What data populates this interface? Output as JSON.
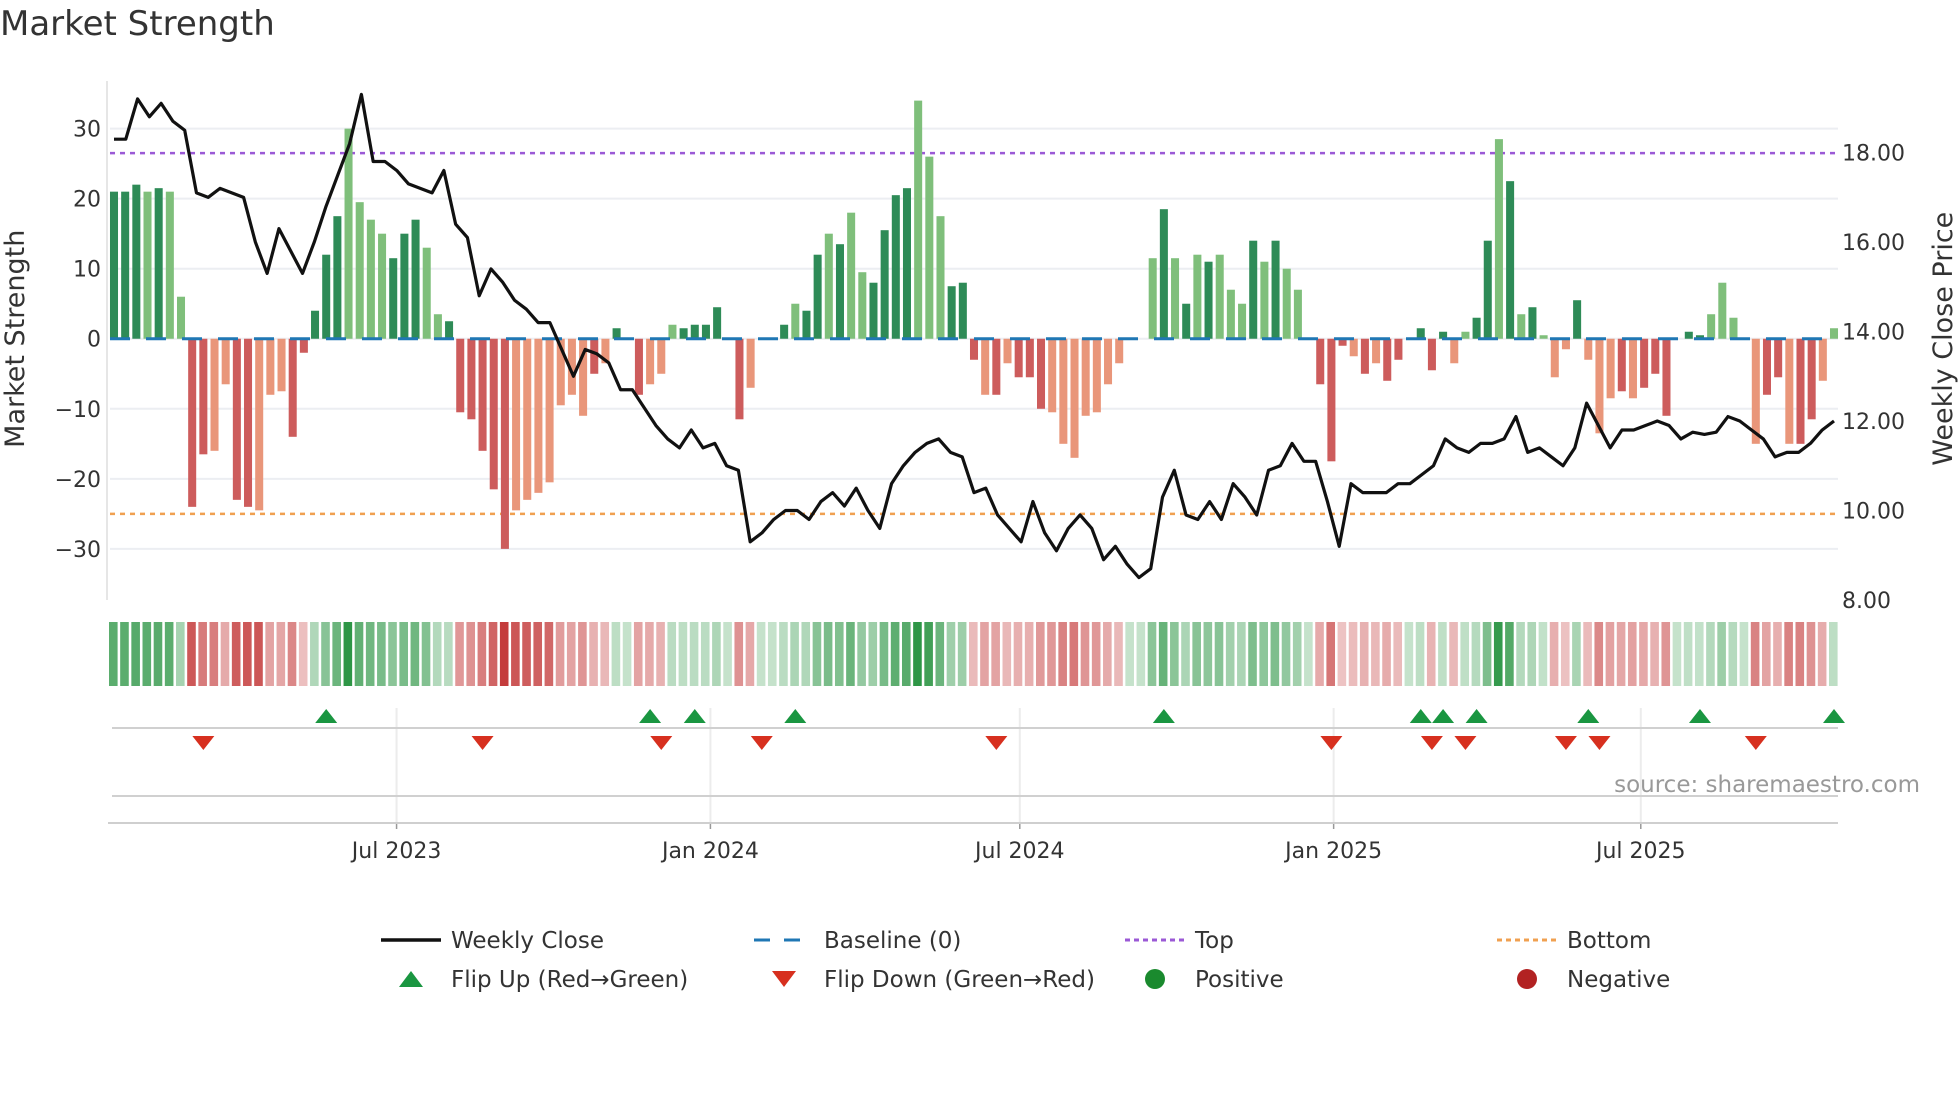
{
  "chart_data": {
    "type": "bar+line",
    "title": "Market Strength",
    "ylabel": "Market Strength",
    "y2label": "Weekly Close Price",
    "ylim": [
      -37.3,
      36.8
    ],
    "y2lim": [
      8.0,
      19.6
    ],
    "yticks": [
      30,
      20,
      10,
      0,
      -10,
      -20,
      -30
    ],
    "ytick_labels": [
      "30",
      "20",
      "10",
      "0",
      "−10",
      "−20",
      "−30"
    ],
    "y2ticks": [
      18,
      16,
      14,
      12,
      10,
      8
    ],
    "y2tick_labels": [
      "18.00",
      "16.00",
      "14.00",
      "12.00",
      "10.00",
      "8.00"
    ],
    "xticks": [
      {
        "label": "Jul 2023",
        "week_index": 25.3
      },
      {
        "label": "Jan 2024",
        "week_index": 53.4
      },
      {
        "label": "Jul 2024",
        "week_index": 81.1
      },
      {
        "label": "Jan 2025",
        "week_index": 109.2
      },
      {
        "label": "Jul 2025",
        "week_index": 136.7
      }
    ],
    "top_threshold": 26.5,
    "bottom_threshold": -25,
    "strength": [
      21,
      21,
      22,
      21,
      21.5,
      21,
      6,
      -24,
      -16.5,
      -16,
      -6.5,
      -23,
      -24,
      -24.5,
      -8,
      -7.5,
      -14,
      -2,
      4,
      12,
      17.5,
      30,
      19.5,
      17,
      15,
      11.5,
      15,
      17,
      13,
      3.5,
      2.5,
      -10.5,
      -11.5,
      -16,
      -21.5,
      -30,
      -24.5,
      -23,
      -22,
      -20.5,
      -9.5,
      -8,
      -11,
      -5,
      -3.5,
      1.5,
      0,
      -8,
      -6.5,
      -5,
      2,
      1.5,
      2,
      2,
      4.5,
      0,
      -11.5,
      -7,
      0,
      0,
      2,
      5,
      4,
      12,
      15,
      13.5,
      18,
      9.5,
      8,
      15.5,
      20.5,
      21.5,
      34,
      26,
      17.5,
      7.5,
      8,
      -3,
      -8,
      -8,
      -3.5,
      -5.5,
      -5.5,
      -10,
      -10.5,
      -15,
      -17,
      -11,
      -10.5,
      -6.5,
      -3.5,
      0,
      0,
      11.5,
      18.5,
      11.5,
      5,
      12,
      11,
      12,
      7,
      5,
      14,
      11,
      14,
      10,
      7,
      0,
      -6.5,
      -17.5,
      -1,
      -2.5,
      -5,
      -3.5,
      -6,
      -3,
      0,
      1.5,
      -4.5,
      1,
      -3.5,
      1,
      3,
      14,
      28.5,
      22.5,
      3.5,
      4.5,
      0.5,
      -5.5,
      -1.5,
      5.5,
      -3,
      -13.5,
      -8.5,
      -7.5,
      -8.5,
      -7,
      -5,
      -11,
      0,
      1,
      0.5,
      3.5,
      8,
      3,
      0,
      -15,
      -8,
      -5.5,
      -15,
      -15,
      -11.5,
      -6,
      1.5
    ],
    "shade": "dddldllddllddllldddddlllldddllddddddllllllldldldlllddddldllddlddldllddddllldddldldddlllllllddldldldllldldllldddldlddddddllddldldllldllldldddlddlllllddlddlldldllldd",
    "weekly_close": [
      18.3,
      18.3,
      19.2,
      18.8,
      19.1,
      18.7,
      18.5,
      17.1,
      17.0,
      17.2,
      17.1,
      17.0,
      16.0,
      15.3,
      16.3,
      15.8,
      15.3,
      16.0,
      16.8,
      17.5,
      18.2,
      19.3,
      17.8,
      17.8,
      17.6,
      17.3,
      17.2,
      17.1,
      17.6,
      16.4,
      16.1,
      14.8,
      15.4,
      15.1,
      14.7,
      14.5,
      14.2,
      14.2,
      13.6,
      13.0,
      13.6,
      13.5,
      13.3,
      12.7,
      12.7,
      12.3,
      11.9,
      11.6,
      11.4,
      11.8,
      11.4,
      11.5,
      11.0,
      10.9,
      9.3,
      9.5,
      9.8,
      10.0,
      10.0,
      9.8,
      10.2,
      10.4,
      10.1,
      10.5,
      10.0,
      9.6,
      10.6,
      11.0,
      11.3,
      11.5,
      11.6,
      11.3,
      11.2,
      10.4,
      10.5,
      9.9,
      9.6,
      9.3,
      10.2,
      9.5,
      9.1,
      9.6,
      9.9,
      9.6,
      8.9,
      9.2,
      8.8,
      8.5,
      8.7,
      10.3,
      10.9,
      9.9,
      9.8,
      10.2,
      9.8,
      10.6,
      10.3,
      9.9,
      10.9,
      11.0,
      11.5,
      11.1,
      11.1,
      10.2,
      9.2,
      10.6,
      10.4,
      10.4,
      10.4,
      10.6,
      10.6,
      10.8,
      11.0,
      11.6,
      11.4,
      11.3,
      11.5,
      11.5,
      11.6,
      12.1,
      11.3,
      11.4,
      11.2,
      11.0,
      11.4,
      12.4,
      11.9,
      11.4,
      11.8,
      11.8,
      11.9,
      12.0,
      11.9,
      11.6,
      11.75,
      11.7,
      11.75,
      12.1,
      12.0,
      11.8,
      11.6,
      11.2,
      11.3,
      11.3,
      11.5,
      11.8,
      12.0
    ],
    "flip_up_indices": [
      19,
      48,
      52,
      61,
      94,
      117,
      119,
      122,
      132,
      142,
      154
    ],
    "flip_down_indices": [
      8,
      33,
      49,
      58,
      79,
      109,
      118,
      121,
      130,
      133,
      147
    ],
    "legend": {
      "placement": "bottom",
      "entries": [
        {
          "label": "Weekly Close",
          "symbol": "line",
          "color": "#111111"
        },
        {
          "label": "Baseline (0)",
          "symbol": "dash",
          "color": "#1f77b4"
        },
        {
          "label": "Top",
          "symbol": "dot",
          "color": "#9b59d6"
        },
        {
          "label": "Bottom",
          "symbol": "dot",
          "color": "#f0a050"
        },
        {
          "label": "Flip Up (Red→Green)",
          "symbol": "triangle-up",
          "color": "#1a9641"
        },
        {
          "label": "Flip Down (Green→Red)",
          "symbol": "triangle-down",
          "color": "#d7301f"
        },
        {
          "label": "Positive",
          "symbol": "circle",
          "color": "#1a8a2e"
        },
        {
          "label": "Negative",
          "symbol": "circle",
          "color": "#b22222"
        }
      ]
    },
    "colors": {
      "pos_dark": "#2e8b57",
      "pos_light": "#7fbf7b",
      "neg_dark": "#cd5c5c",
      "neg_light": "#e9967a"
    }
  },
  "source": "source: sharemaestro.com"
}
